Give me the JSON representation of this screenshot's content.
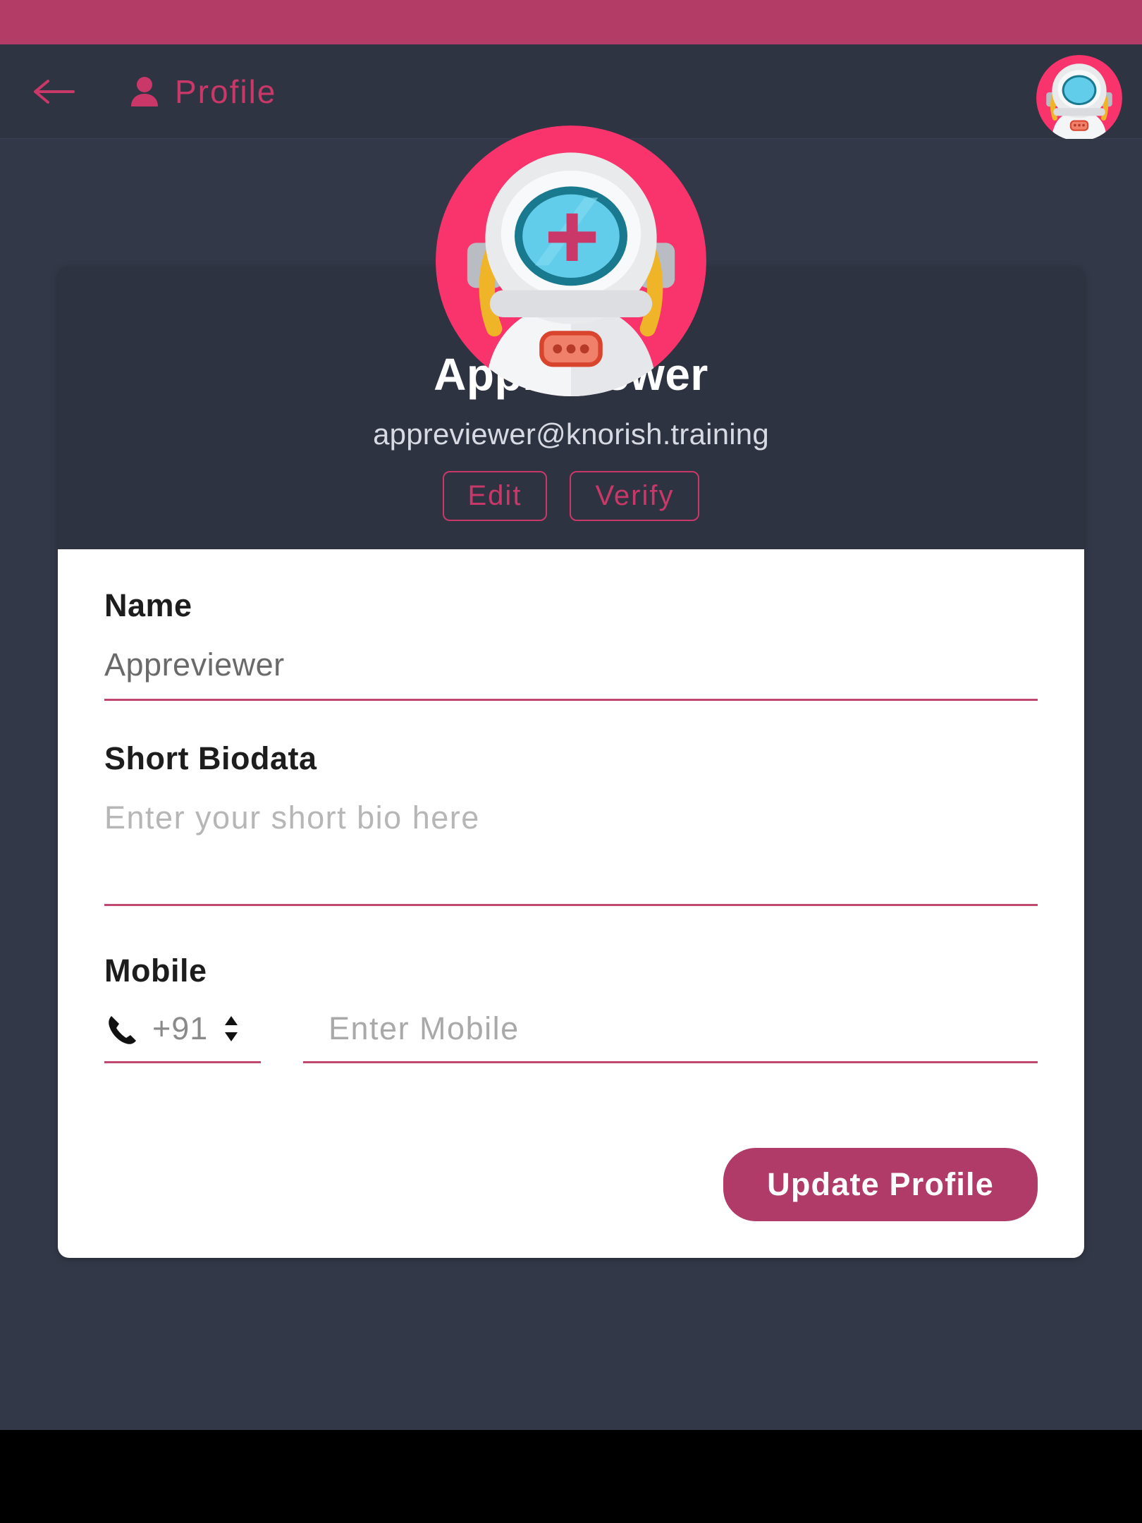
{
  "header": {
    "title": "Profile",
    "back_icon": "arrow-left-icon",
    "person_icon": "person-icon",
    "avatar_alt": "astronaut-avatar"
  },
  "profile": {
    "avatar_alt": "astronaut-avatar",
    "name": "Appreviewer",
    "email": "appreviewer@knorish.training",
    "edit_label": "Edit",
    "verify_label": "Verify"
  },
  "form": {
    "name_label": "Name",
    "name_value": "Appreviewer",
    "bio_label": "Short Biodata",
    "bio_placeholder": "Enter your short bio here",
    "mobile_label": "Mobile",
    "country_code": "+91",
    "mobile_placeholder": "Enter Mobile",
    "submit_label": "Update Profile"
  },
  "colors": {
    "status_bar": "#b23c66",
    "header_bg": "#2f3442",
    "accent_pink": "#c93868",
    "button_pink": "#b13b68",
    "page_bg": "#333848",
    "card_dark": "#2e3342",
    "card_light": "#ffffff",
    "underline": "#c0486e",
    "avatar_ring": "#f9336b"
  }
}
